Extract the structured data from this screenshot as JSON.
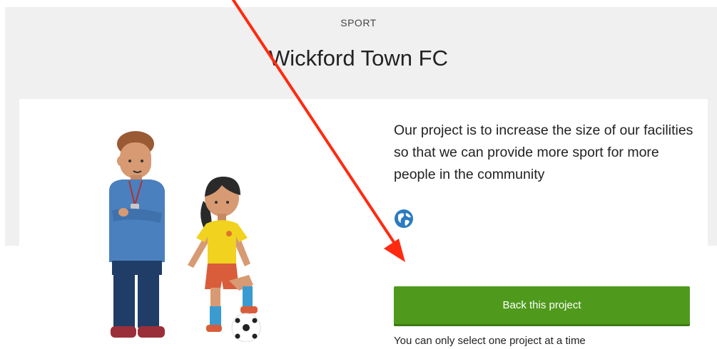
{
  "project": {
    "category": "SPORT",
    "title": "Wickford Town FC",
    "description": "Our project is to increase the size of our facilities so that we can provide more sport for more people in the community",
    "website_icon": "globe-icon",
    "back_button_label": "Back this project",
    "selection_note": "You can only select one project at a time"
  },
  "colors": {
    "button": "#4f9a1c",
    "annotation_arrow": "#ff2a10",
    "globe": "#2b7bc0"
  }
}
